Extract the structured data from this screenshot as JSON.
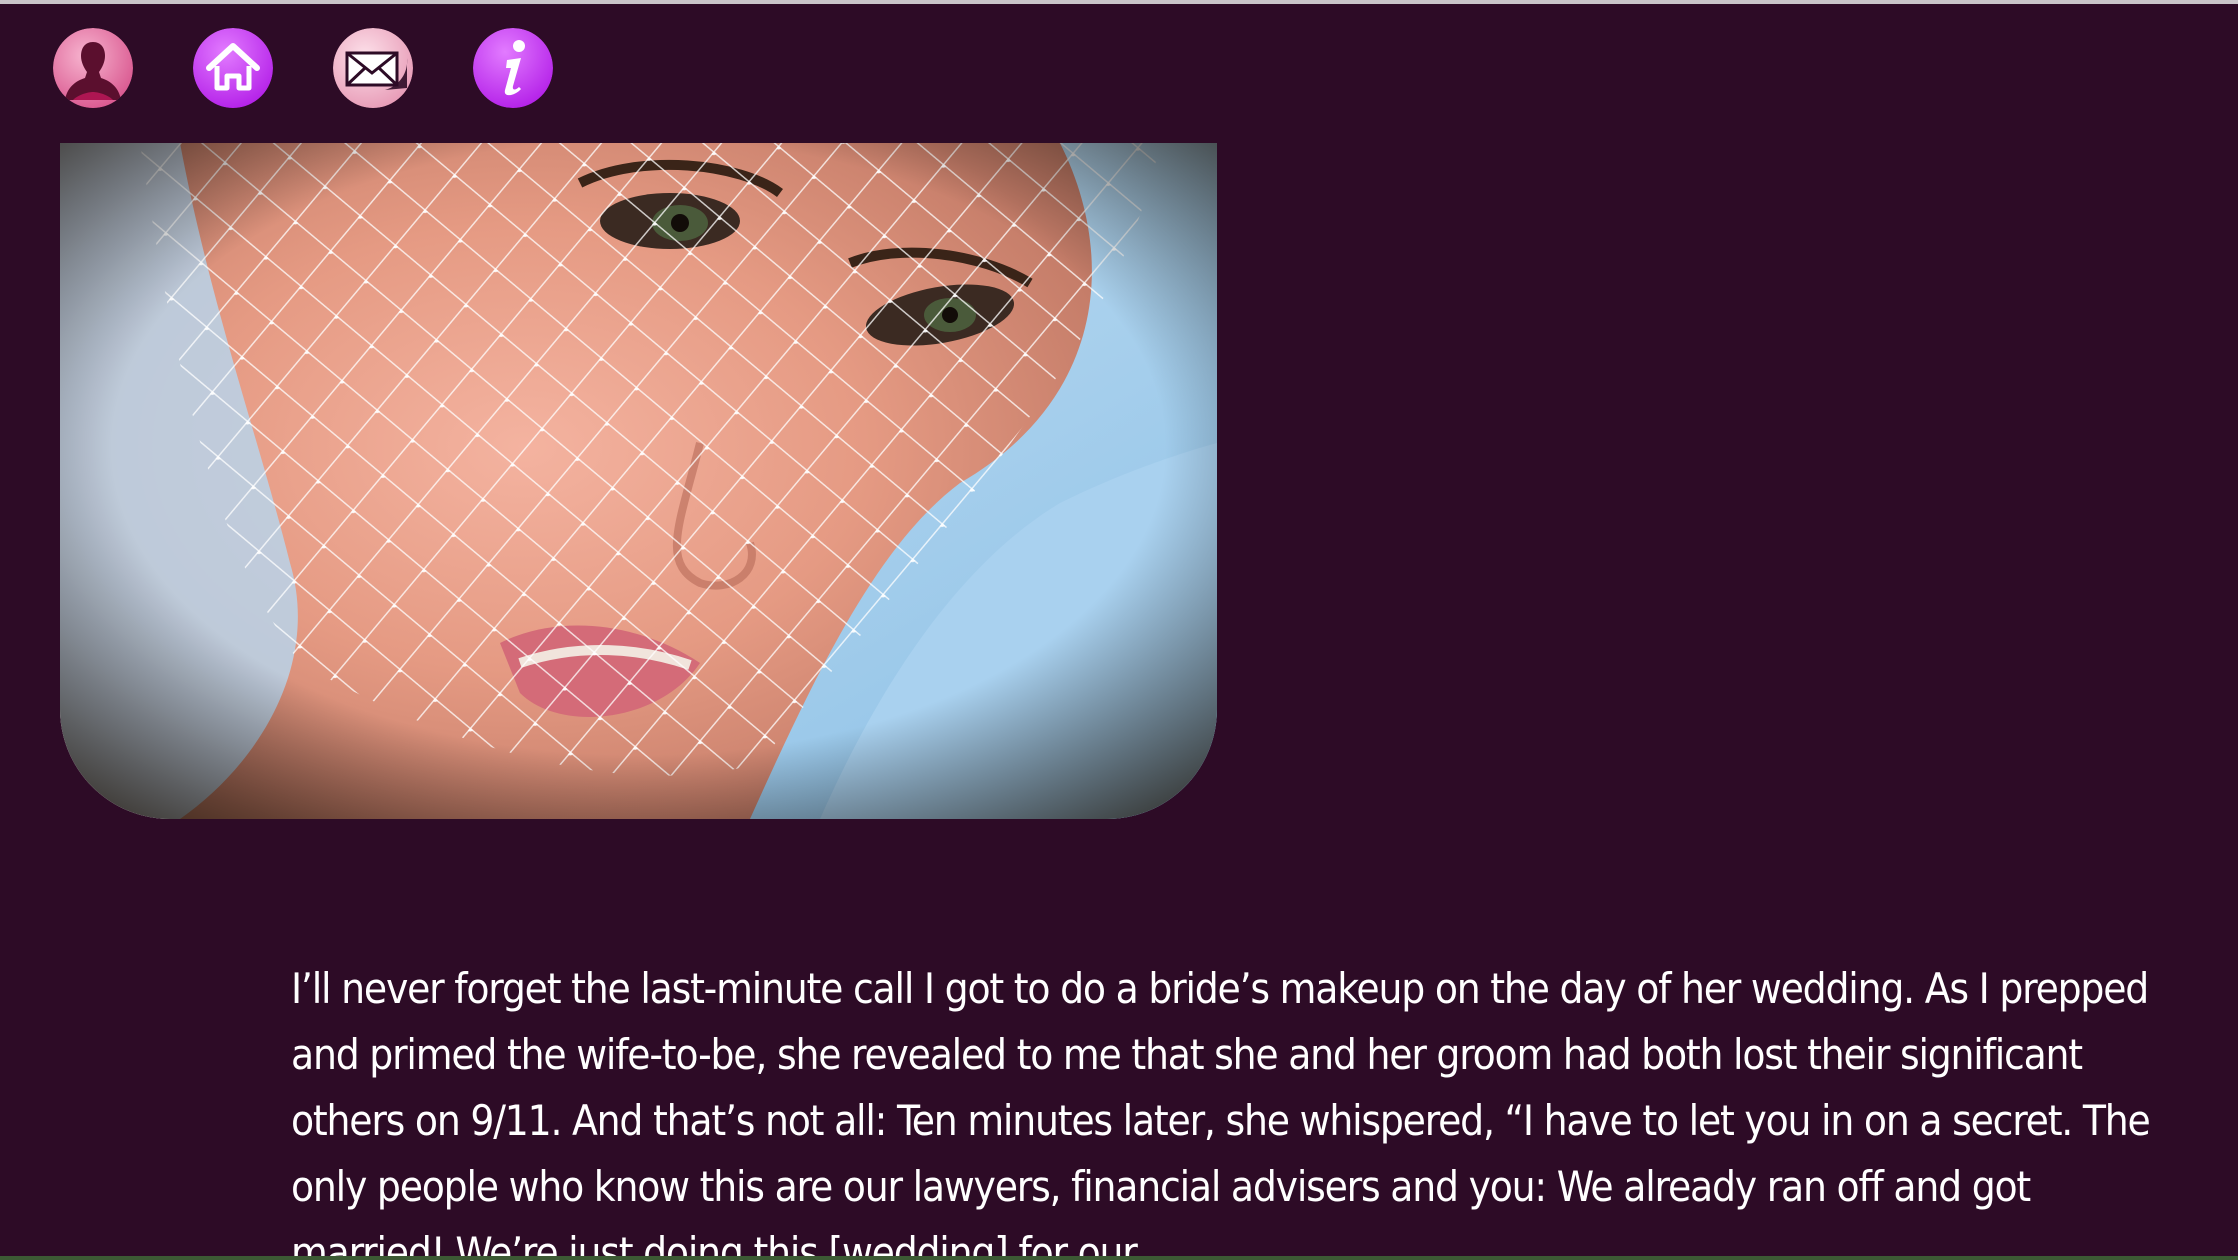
{
  "nav": {
    "items": [
      {
        "name": "profile",
        "icon": "profile-silhouette-icon",
        "color": "#e05a9c"
      },
      {
        "name": "home",
        "icon": "home-icon",
        "color": "#cc33ff"
      },
      {
        "name": "mail",
        "icon": "envelope-icon",
        "color": "#f2c6d6"
      },
      {
        "name": "info",
        "icon": "info-icon",
        "color": "#cc33ff"
      }
    ]
  },
  "hero": {
    "subject": "bride-with-birdcage-veil-photo"
  },
  "article": {
    "body": "I’ll never forget the last-minute call I got to do a bride’s makeup on the day of her wedding. As I prepped and primed the wife-to-be, she revealed to me that she and her groom had both lost their significant others on 9/11. And that’s not all: Ten minutes later, she whispered, “I have to let you in on a secret. The only people who know this are our lawyers, financial advisers and you: We already ran off and got married! We’re just doing this [wedding] for our"
  },
  "colors": {
    "background": "#2d0b26",
    "text": "#ffffff",
    "accent": "#cc33ff"
  }
}
